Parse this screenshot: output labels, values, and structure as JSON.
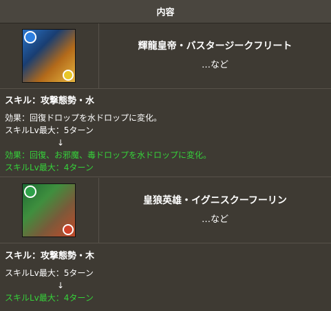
{
  "header": {
    "title": "内容"
  },
  "rows": [
    {
      "monster": {
        "name": "輝龍皇帝・バスタージークフリート",
        "etc": "…など"
      },
      "skill": {
        "title": "スキル：攻撃態勢・水",
        "before_effect": "効果：回復ドロップを水ドロップに変化。",
        "before_turn": "スキルLv最大：5ターン",
        "arrow": "↓",
        "after_effect": "効果：回復、お邪魔、毒ドロップを水ドロップに変化。",
        "after_turn": "スキルLv最大：4ターン"
      }
    },
    {
      "monster": {
        "name": "皇狼英雄・イグニスクーフーリン",
        "etc": "…など"
      },
      "skill": {
        "title": "スキル：攻撃態勢・木",
        "before_turn": "スキルLv最大：5ターン",
        "arrow": "↓",
        "after_turn": "スキルLv最大：4ターン"
      }
    }
  ],
  "colors": {
    "highlight": "#36d23a",
    "text": "#ffffff",
    "background": "#3e3a33"
  }
}
